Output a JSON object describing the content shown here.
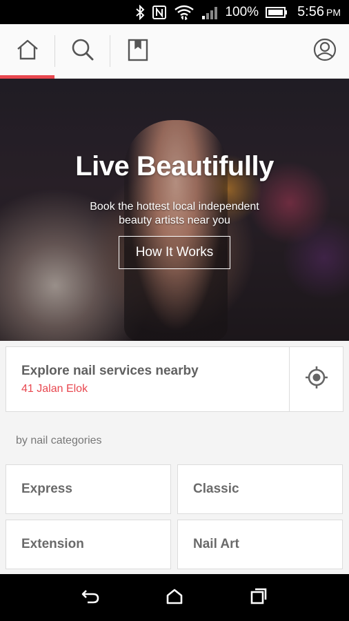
{
  "status_bar": {
    "battery": "100%",
    "time": "5:56",
    "ampm": "PM",
    "icons": [
      "bluetooth-icon",
      "nfc-icon",
      "wifi-icon",
      "signal-icon",
      "battery-icon"
    ]
  },
  "nav": {
    "tabs": [
      "home-icon",
      "search-icon",
      "bookmark-icon"
    ],
    "active_tab": "home",
    "profile_icon": "profile-icon",
    "accent_color": "#e8474f"
  },
  "hero": {
    "title": "Live Beautifully",
    "subtitle": "Book the hottest local independent beauty artists near you",
    "button_label": "How It Works"
  },
  "explore": {
    "title": "Explore nail services nearby",
    "address": "41 Jalan Elok",
    "locate_icon": "locate-icon"
  },
  "categories": {
    "label": "by nail categories",
    "items": [
      "Express",
      "Classic",
      "Extension",
      "Nail Art"
    ]
  },
  "system_nav": {
    "icons": [
      "back-icon",
      "home-nav-icon",
      "recents-icon"
    ]
  }
}
